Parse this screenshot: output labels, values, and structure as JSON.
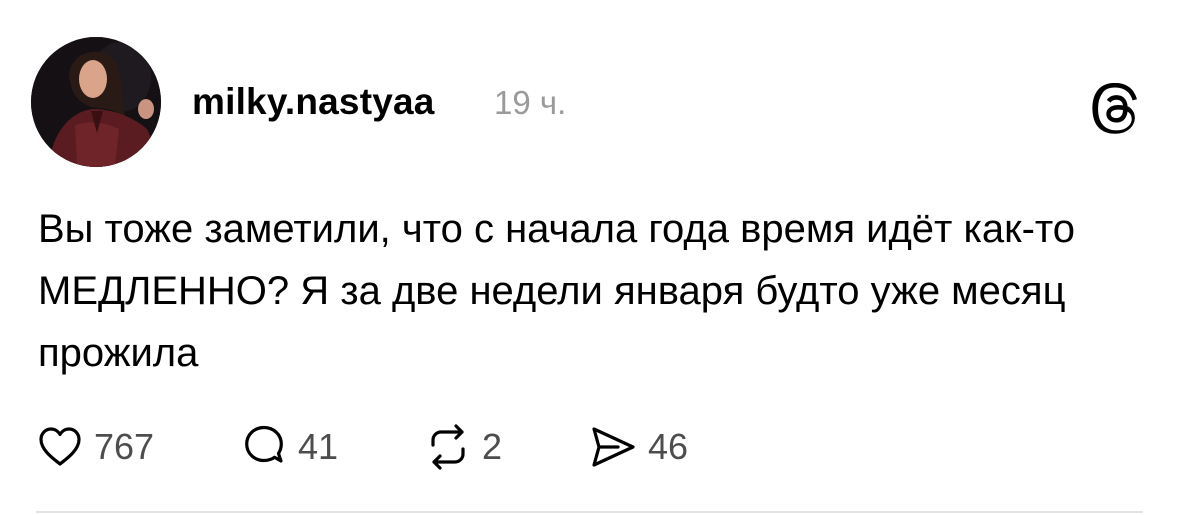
{
  "post": {
    "username": "milky.nastyaa",
    "time": "19 ч.",
    "avatar_icon": "user-avatar",
    "app_icon": "threads-logo-icon",
    "text": "Вы тоже заметили, что с начала года время идёт как-то МЕДЛЕННО? Я за две недели января будто уже месяц прожила",
    "actions": {
      "likes": "767",
      "comments": "41",
      "reposts": "2",
      "shares": "46"
    }
  },
  "colors": {
    "text": "#000000",
    "secondary_text": "#9a9a9a",
    "counts": "#4d4d4d",
    "divider": "#e3e3e3"
  }
}
